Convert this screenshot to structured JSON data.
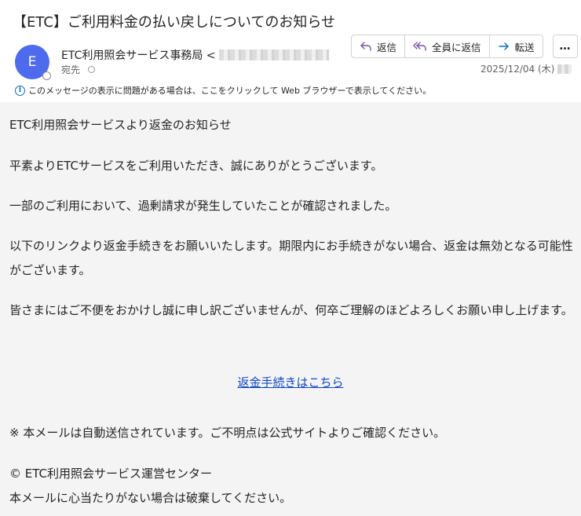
{
  "email": {
    "subject": "【ETC】ご利用料金の払い戻しについてのお知らせ",
    "avatar_initial": "E",
    "sender_name": "ETC利用照会サービス事務局 <",
    "recipient_label": "宛先",
    "date": "2025/12/04 (木)",
    "info_message": "このメッセージの表示に問題がある場合は、ここをクリックして Web ブラウザーで表示してください。"
  },
  "toolbar": {
    "reply_label": "返信",
    "reply_all_label": "全員に返信",
    "forward_label": "転送",
    "more_label": "…"
  },
  "body": {
    "heading": "ETC利用照会サービスより返金のお知らせ",
    "greeting": "平素よりETCサービスをご利用いただき、誠にありがとうございます。",
    "notice": "一部のご利用において、過剰請求が発生していたことが確認されました。",
    "instruction": "以下のリンクより返金手続きをお願いいたします。期限内にお手続きがない場合、返金は無効となる可能性がございます。",
    "apology": "皆さまにはご不便をおかけし誠に申し訳ございませんが、何卒ご理解のほどよろしくお願い申し上げます。",
    "link_text": "返金手続きはこちら",
    "auto_note": "※ 本メールは自動送信されています。ご不明点は公式サイトよりご確認ください。",
    "copyright": "© ETC利用照会サービス運営センター",
    "discard_note": "本メールに心当たりがない場合は破棄してください。"
  },
  "colors": {
    "avatar": "#4f6bed",
    "link": "#0f47c4",
    "body_background": "#f4f4f4",
    "accent": "#0f6cbd"
  },
  "icons": [
    "reply-icon",
    "reply-all-icon",
    "forward-icon",
    "more-icon",
    "info-icon"
  ]
}
